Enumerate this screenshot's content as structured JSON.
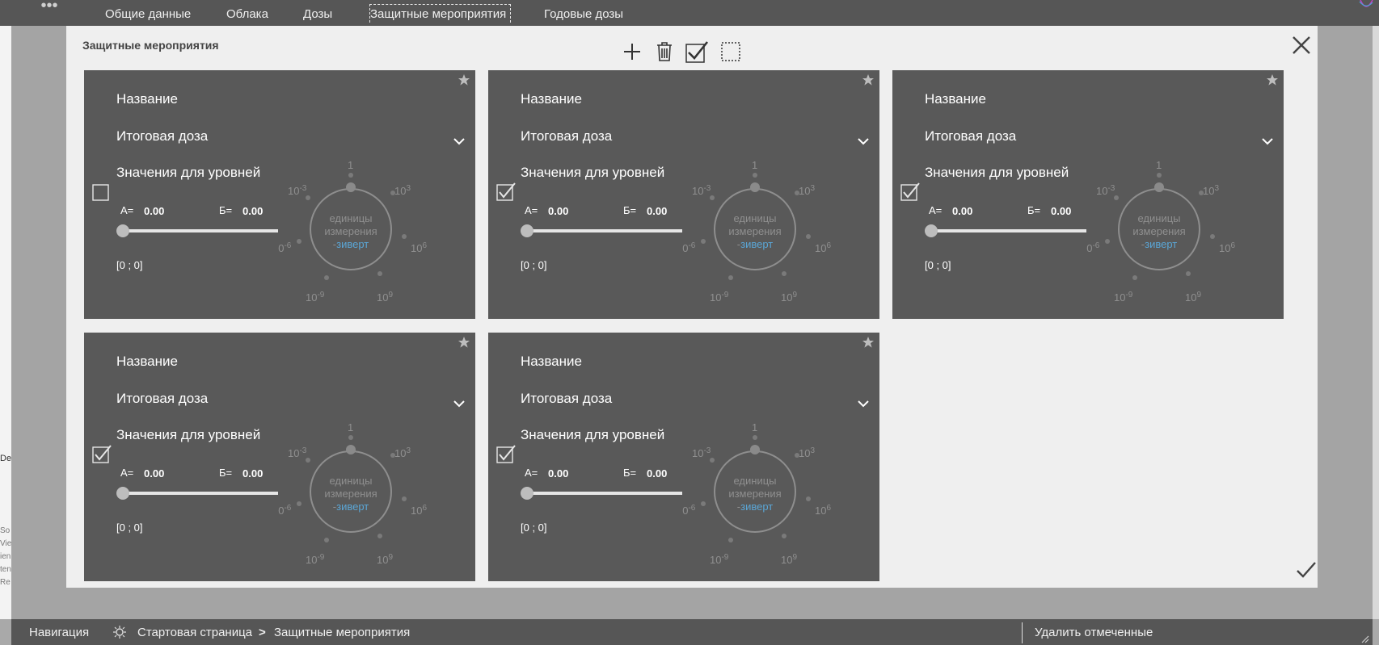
{
  "menu": {
    "more": "•••",
    "tabs": [
      "Общие данные",
      "Облака",
      "Дозы",
      "Защитные мероприятия",
      "Годовые дозы"
    ]
  },
  "left_fragments": [
    "De",
    "So",
    "Vie",
    "ien",
    "ten",
    "Re"
  ],
  "dialog": {
    "title": "Защитные мероприятия"
  },
  "card_template": {
    "name_label": "Название",
    "dose_label": "Итоговая доза",
    "levels_label": "Значения для уровней",
    "a_label": "А=",
    "b_label": "Б=",
    "dial_units_1": "единицы",
    "dial_units_2": "измерения",
    "dial_units_dash": "-",
    "dial_units_3": "зиверт",
    "ticks": {
      "t1": "1",
      "t3b": "10",
      "t3e": "-3",
      "t3pb": "10",
      "t3pe": "3",
      "t6b": "10",
      "t6e": "-6",
      "t6pb": "10",
      "t6pe": "6",
      "t9b": "10",
      "t9e": "-9",
      "t9pb": "10",
      "t9pe": "9"
    }
  },
  "cards": [
    {
      "checked": false,
      "a_value": "0.00",
      "b_value": "0.00",
      "range": "[0 ; 0]"
    },
    {
      "checked": true,
      "a_value": "0.00",
      "b_value": "0.00",
      "range": "[0 ; 0]"
    },
    {
      "checked": true,
      "a_value": "0.00",
      "b_value": "0.00",
      "range": "[0 ; 0]"
    },
    {
      "checked": true,
      "a_value": "0.00",
      "b_value": "0.00",
      "range": "[0 ; 0]"
    },
    {
      "checked": true,
      "a_value": "0.00",
      "b_value": "0.00",
      "range": "[0 ; 0]"
    }
  ],
  "statusbar": {
    "nav": "Навигация",
    "home": "Стартовая страница",
    "sep": ">",
    "current": "Защитные мероприятия",
    "delete": "Удалить отмеченные"
  },
  "colors": {
    "card_bg": "#595959",
    "dialog_bg": "#efefef",
    "bars": "#565656",
    "units_accent": "#5aa6d6"
  }
}
